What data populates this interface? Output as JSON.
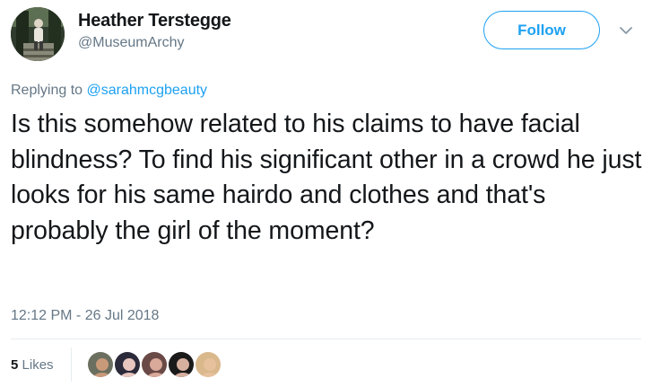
{
  "author": {
    "display_name": "Heather Terstegge",
    "handle": "@MuseumArchy",
    "avatar_icon": "person-photo-avatar"
  },
  "follow_button": {
    "label": "Follow",
    "color": "#1da1f2"
  },
  "menu": {
    "icon": "chevron-down-icon"
  },
  "reply": {
    "prefix": "Replying to",
    "mention": "@sarahmcgbeauty"
  },
  "tweet": {
    "text": "Is this somehow related to his claims to have facial blindness? To find his significant other in a crowd he just looks for his same hairdo and clothes and that's probably the girl of the moment?",
    "timestamp": "12:12 PM - 26 Jul 2018"
  },
  "engagement": {
    "likes_count": "5",
    "likes_label": "Likes",
    "likers": [
      {
        "icon": "man-avatar",
        "skin": "#c99a7a",
        "bg": "#6b6f5f"
      },
      {
        "icon": "woman-avatar",
        "skin": "#e8c6c0",
        "bg": "#2a2a3a"
      },
      {
        "icon": "woman-avatar",
        "skin": "#d9a99a",
        "bg": "#6a4a46"
      },
      {
        "icon": "woman-avatar",
        "skin": "#d8b0a0",
        "bg": "#1a1a1a"
      },
      {
        "icon": "woman-avatar",
        "skin": "#e7c19e",
        "bg": "#d9b88c"
      }
    ]
  },
  "colors": {
    "link_blue": "#1da1f2",
    "secondary_text": "#657786",
    "primary_text": "#14171a"
  }
}
